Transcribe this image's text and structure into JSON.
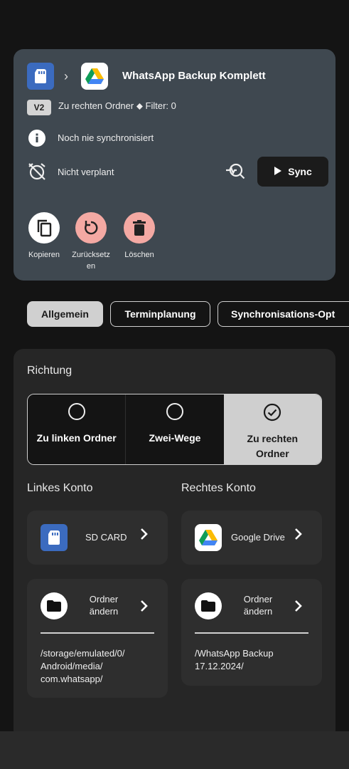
{
  "header": {
    "title": "WhatsApp Backup Komplett",
    "version_badge": "V2",
    "target_filter": "Zu rechten Ordner  ⬥  Filter: 0",
    "sync_status": "Noch nie synchronisiert",
    "schedule_status": "Nicht verplant",
    "sync_label": "Sync"
  },
  "actions": [
    {
      "label": "Kopieren"
    },
    {
      "label": "Zurücksetz\nen"
    },
    {
      "label": "Löschen"
    }
  ],
  "tabs": [
    {
      "label": "Allgemein",
      "selected": true
    },
    {
      "label": "Terminplanung",
      "selected": false
    },
    {
      "label": "Synchronisations-Opt",
      "selected": false
    }
  ],
  "direction": {
    "heading": "Richtung",
    "options": [
      {
        "label": "Zu linken Ordner",
        "selected": false
      },
      {
        "label": "Zwei-Wege",
        "selected": false
      },
      {
        "label": "Zu rechten\nOrdner",
        "selected": true
      }
    ]
  },
  "left": {
    "heading": "Linkes Konto",
    "account": "SD CARD",
    "folder_button": "Ordner\nändern",
    "path": "/storage/emulated/0/\nAndroid/media/\ncom.whatsapp/"
  },
  "right": {
    "heading": "Rechtes Konto",
    "account": "Google Drive",
    "folder_button": "Ordner\nändern",
    "path": "/WhatsApp Backup\n17.12.2024/"
  },
  "colors": {
    "card": "#3f4850",
    "sd_blue": "#3b6bbf",
    "action_red": "#f4a9a3",
    "selected": "#cfcfcf"
  }
}
